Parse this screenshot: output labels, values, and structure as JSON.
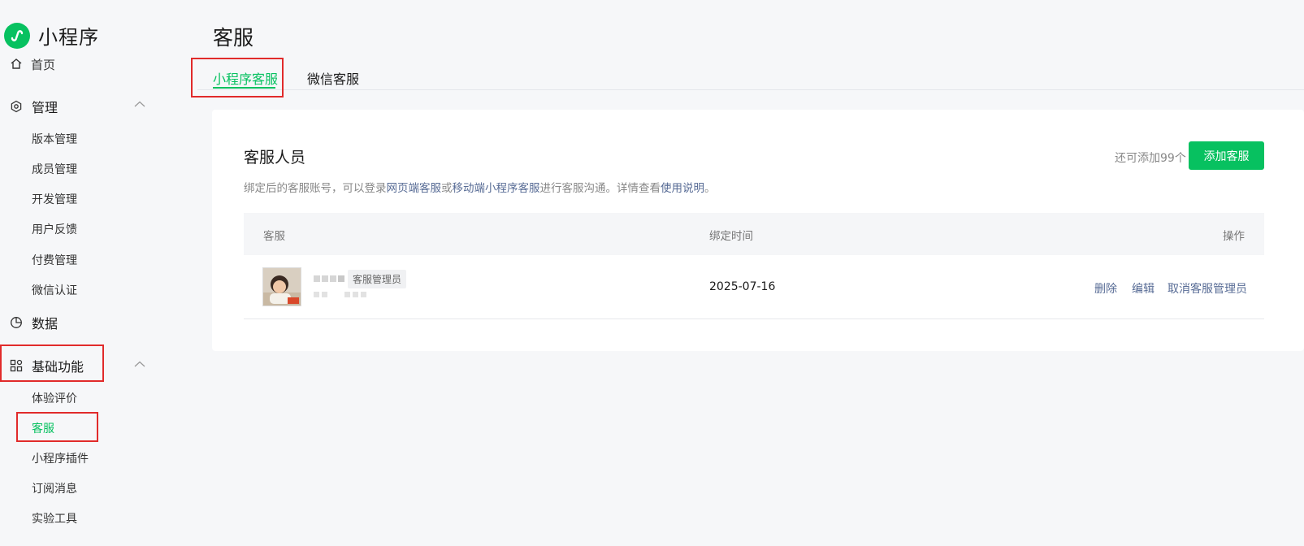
{
  "app": {
    "name": "小程序"
  },
  "sidebar": {
    "home": "首页",
    "manage": {
      "label": "管理",
      "items": [
        "版本管理",
        "成员管理",
        "开发管理",
        "用户反馈",
        "付费管理",
        "微信认证"
      ]
    },
    "data": "数据",
    "basic": {
      "label": "基础功能",
      "items": [
        "体验评价",
        "客服",
        "小程序插件",
        "订阅消息",
        "实验工具"
      ],
      "active": "客服"
    }
  },
  "page": {
    "title": "客服"
  },
  "tabs": [
    {
      "label": "小程序客服",
      "active": true
    },
    {
      "label": "微信客服",
      "active": false
    }
  ],
  "card": {
    "title": "客服人员",
    "desc": {
      "p1": "绑定后的客服账号，可以登录",
      "link1": "网页端客服",
      "p2": "或",
      "link2": "移动端小程序客服",
      "p3": "进行客服沟通。详情查看",
      "link3": "使用说明",
      "p4": "。"
    },
    "quota": "还可添加99个",
    "add_button": "添加客服"
  },
  "table": {
    "headers": {
      "agent": "客服",
      "bind_time": "绑定时间",
      "actions": "操作"
    },
    "rows": [
      {
        "role": "客服管理员",
        "bind_time": "2025-07-16",
        "actions": {
          "delete": "删除",
          "edit": "编辑",
          "revoke": "取消客服管理员"
        }
      }
    ]
  },
  "colors": {
    "accent": "#07c160",
    "link": "#576b95",
    "highlight": "#e12b2b"
  }
}
